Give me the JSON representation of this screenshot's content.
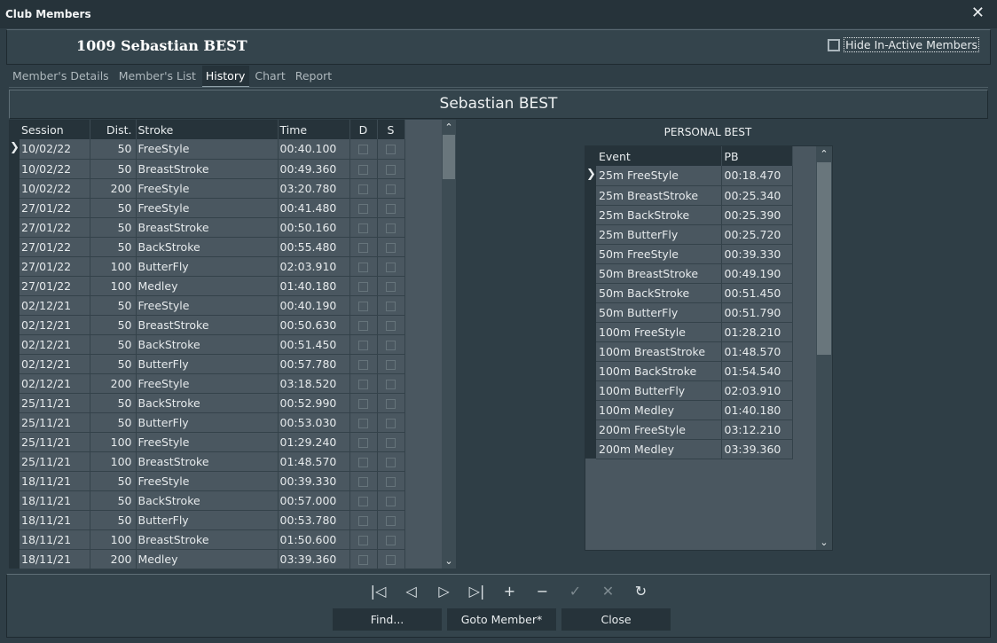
{
  "window": {
    "title": "Club Members",
    "close_glyph": "✕"
  },
  "header": {
    "member_title": "1009 Sebastian BEST",
    "hide_inactive_label": "Hide In-Active Members",
    "hide_inactive_checked": false
  },
  "tabs": [
    {
      "label": "Member's Details",
      "active": false
    },
    {
      "label": "Member's List",
      "active": false
    },
    {
      "label": "History",
      "active": true
    },
    {
      "label": "Chart",
      "active": false
    },
    {
      "label": "Report",
      "active": false
    }
  ],
  "panel_title": "Sebastian BEST",
  "history": {
    "columns": [
      "Session",
      "Dist.",
      "Stroke",
      "Time",
      "D",
      "S"
    ],
    "current_row": 0,
    "rows": [
      [
        "10/02/22",
        "50",
        "FreeStyle",
        "00:40.100"
      ],
      [
        "10/02/22",
        "50",
        "BreastStroke",
        "00:49.360"
      ],
      [
        "10/02/22",
        "200",
        "FreeStyle",
        "03:20.780"
      ],
      [
        "27/01/22",
        "50",
        "FreeStyle",
        "00:41.480"
      ],
      [
        "27/01/22",
        "50",
        "BreastStroke",
        "00:50.160"
      ],
      [
        "27/01/22",
        "50",
        "BackStroke",
        "00:55.480"
      ],
      [
        "27/01/22",
        "100",
        "ButterFly",
        "02:03.910"
      ],
      [
        "27/01/22",
        "100",
        "Medley",
        "01:40.180"
      ],
      [
        "02/12/21",
        "50",
        "FreeStyle",
        "00:40.190"
      ],
      [
        "02/12/21",
        "50",
        "BreastStroke",
        "00:50.630"
      ],
      [
        "02/12/21",
        "50",
        "BackStroke",
        "00:51.450"
      ],
      [
        "02/12/21",
        "50",
        "ButterFly",
        "00:57.780"
      ],
      [
        "02/12/21",
        "200",
        "FreeStyle",
        "03:18.520"
      ],
      [
        "25/11/21",
        "50",
        "BackStroke",
        "00:52.990"
      ],
      [
        "25/11/21",
        "50",
        "ButterFly",
        "00:53.030"
      ],
      [
        "25/11/21",
        "100",
        "FreeStyle",
        "01:29.240"
      ],
      [
        "25/11/21",
        "100",
        "BreastStroke",
        "01:48.570"
      ],
      [
        "18/11/21",
        "50",
        "FreeStyle",
        "00:39.330"
      ],
      [
        "18/11/21",
        "50",
        "BackStroke",
        "00:57.000"
      ],
      [
        "18/11/21",
        "50",
        "ButterFly",
        "00:53.780"
      ],
      [
        "18/11/21",
        "100",
        "BreastStroke",
        "01:50.600"
      ],
      [
        "18/11/21",
        "200",
        "Medley",
        "03:39.360"
      ]
    ]
  },
  "personal_best": {
    "label": "PERSONAL BEST",
    "columns": [
      "Event",
      "PB"
    ],
    "current_row": 0,
    "rows": [
      [
        "25m FreeStyle",
        "00:18.470"
      ],
      [
        "25m BreastStroke",
        "00:25.340"
      ],
      [
        "25m BackStroke",
        "00:25.390"
      ],
      [
        "25m ButterFly",
        "00:25.720"
      ],
      [
        "50m FreeStyle",
        "00:39.330"
      ],
      [
        "50m BreastStroke",
        "00:49.190"
      ],
      [
        "50m BackStroke",
        "00:51.450"
      ],
      [
        "50m ButterFly",
        "00:51.790"
      ],
      [
        "100m FreeStyle",
        "01:28.210"
      ],
      [
        "100m BreastStroke",
        "01:48.570"
      ],
      [
        "100m BackStroke",
        "01:54.540"
      ],
      [
        "100m ButterFly",
        "02:03.910"
      ],
      [
        "100m Medley",
        "01:40.180"
      ],
      [
        "200m FreeStyle",
        "03:12.210"
      ],
      [
        "200m Medley",
        "03:39.360"
      ]
    ]
  },
  "navigator": [
    {
      "name": "first-record",
      "glyph": "|◁",
      "enabled": true
    },
    {
      "name": "prior-record",
      "glyph": "◁",
      "enabled": true
    },
    {
      "name": "next-record",
      "glyph": "▷",
      "enabled": true
    },
    {
      "name": "last-record",
      "glyph": "▷|",
      "enabled": true
    },
    {
      "name": "insert-record",
      "glyph": "+",
      "enabled": true
    },
    {
      "name": "delete-record",
      "glyph": "−",
      "enabled": true
    },
    {
      "name": "post-edit",
      "glyph": "✓",
      "enabled": false
    },
    {
      "name": "cancel-edit",
      "glyph": "✕",
      "enabled": false
    },
    {
      "name": "refresh-data",
      "glyph": "↻",
      "enabled": true
    }
  ],
  "buttons": {
    "find": "Find...",
    "goto": "Goto Member*",
    "close": "Close"
  },
  "scroll": {
    "up": "⌃",
    "down": "⌄"
  },
  "row_pointer": "❯"
}
